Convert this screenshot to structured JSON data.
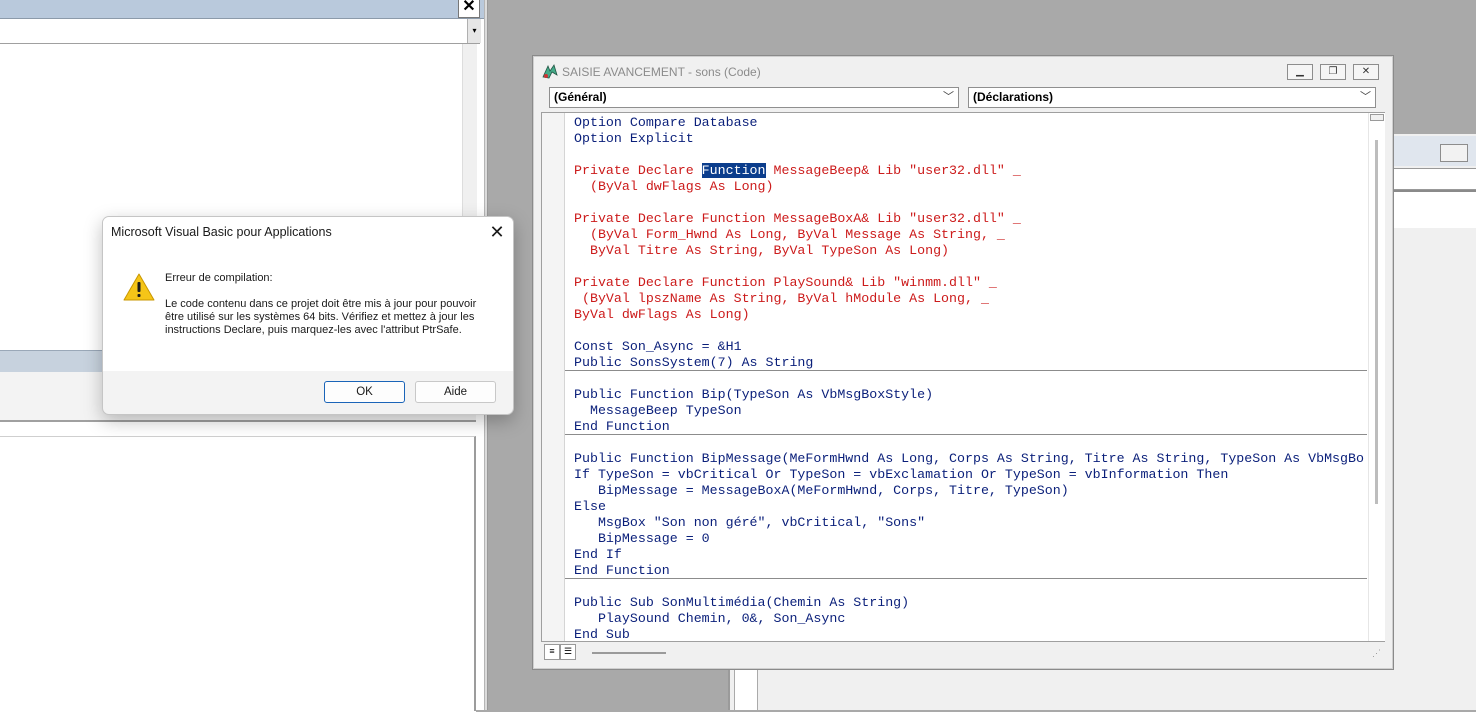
{
  "dialog": {
    "title": "Microsoft Visual Basic pour Applications",
    "heading": "Erreur de compilation:",
    "message": "Le code contenu dans ce projet doit être mis à jour pour pouvoir être utilisé sur les systèmes 64 bits. Vérifiez et mettez à jour les instructions Declare, puis marquez-les avec l'attribut PtrSafe.",
    "ok_label": "OK",
    "help_label": "Aide",
    "close_glyph": "✕"
  },
  "code_window": {
    "title": "SAISIE AVANCEMENT - sons (Code)",
    "object_combo": "(Général)",
    "procedure_combo": "(Déclarations)",
    "colors": {
      "keyword": "#0a1f7a",
      "error": "#cc1b1b",
      "selection": "#0b3d8c"
    },
    "lines": {
      "l1": "Option Compare Database",
      "l2": "Option Explicit",
      "l3": "",
      "l4a": "Private Declare ",
      "l4b": "Function",
      "l4c": " MessageBeep& Lib \"user32.dll\" _",
      "l5": "  (ByVal dwFlags As Long)",
      "l6": "",
      "l7": "Private Declare Function MessageBoxA& Lib \"user32.dll\" _",
      "l8": "  (ByVal Form_Hwnd As Long, ByVal Message As String, _",
      "l9": "  ByVal Titre As String, ByVal TypeSon As Long)",
      "l10": "",
      "l11": "Private Declare Function PlaySound& Lib \"winmm.dll\" _",
      "l12": " (ByVal lpszName As String, ByVal hModule As Long, _",
      "l13": "ByVal dwFlags As Long)",
      "l14": "",
      "l15": "Const Son_Async = &H1",
      "l16": "Public SonsSystem(7) As String",
      "l17": "",
      "l18": "Public Function Bip(TypeSon As VbMsgBoxStyle)",
      "l19": "  MessageBeep TypeSon",
      "l20": "End Function",
      "l21": "",
      "l22": "Public Function BipMessage(MeFormHwnd As Long, Corps As String, Titre As String, TypeSon As VbMsgBo",
      "l23": "If TypeSon = vbCritical Or TypeSon = vbExclamation Or TypeSon = vbInformation Then",
      "l24": "   BipMessage = MessageBoxA(MeFormHwnd, Corps, Titre, TypeSon)",
      "l25": "Else",
      "l26": "   MsgBox \"Son non géré\", vbCritical, \"Sons\"",
      "l27": "   BipMessage = 0",
      "l28": "End If",
      "l29": "End Function",
      "l30": "",
      "l31": "Public Sub SonMultimédia(Chemin As String)",
      "l32": "   PlaySound Chemin, 0&, Son_Async",
      "l33": "End Sub"
    }
  },
  "left_window": {
    "close_glyph": "✕"
  }
}
